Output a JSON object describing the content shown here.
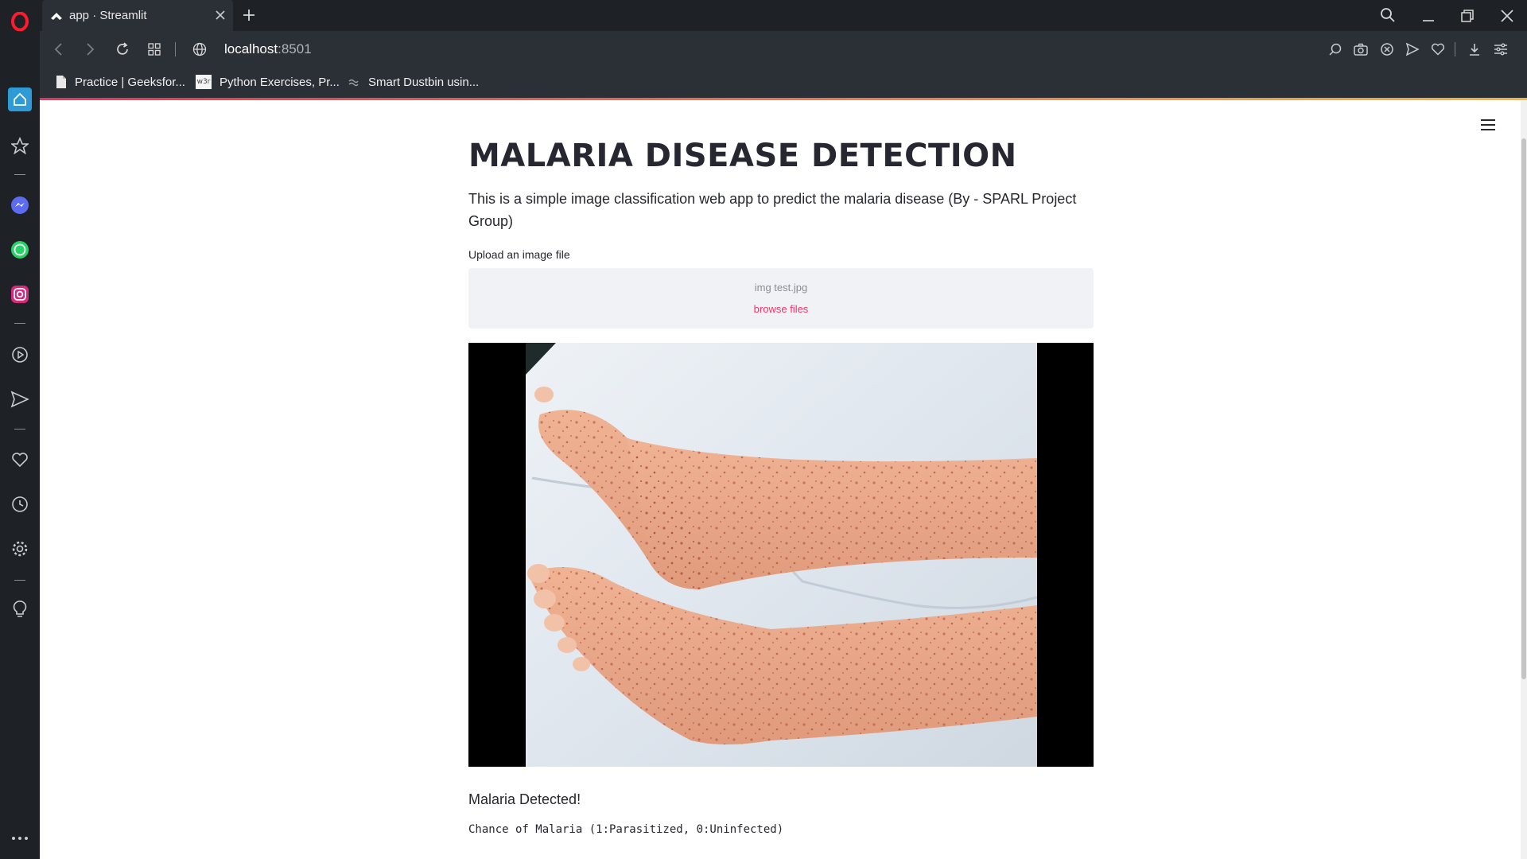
{
  "browser": {
    "tab_title": "app · Streamlit",
    "address": "localhost",
    "port": ":8501",
    "bookmarks": [
      {
        "label": "Practice | Geeksfor...",
        "icon": "document-icon"
      },
      {
        "label": "Python Exercises, Pr...",
        "icon": "w3r-icon"
      },
      {
        "label": "Smart Dustbin usin...",
        "icon": "wave-icon"
      }
    ],
    "sidebar_icons": [
      "opera-logo",
      "home-icon",
      "star-icon",
      "messenger-icon",
      "whatsapp-icon",
      "instagram-icon",
      "player-icon",
      "send-icon",
      "heart-icon",
      "history-icon",
      "settings-icon",
      "bulb-icon",
      "more-icon"
    ]
  },
  "app": {
    "title": "MALARIA DISEASE DETECTION",
    "description": "This is a simple image classification web app to predict the malaria disease (By - SPARL Project Group)",
    "upload_label": "Upload an image file",
    "uploaded_file": "img test.jpg",
    "browse_label": "browse files",
    "result": "Malaria Detected!",
    "chance_text": "Chance of Malaria (1:Parasitized, 0:Uninfected)"
  },
  "colors": {
    "accent": "#f63366",
    "text": "#262730",
    "browser_dark": "#1e2125"
  }
}
